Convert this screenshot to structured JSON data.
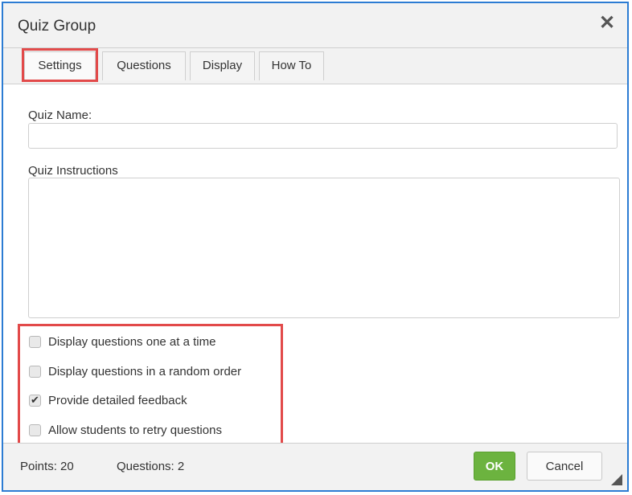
{
  "dialog": {
    "title": "Quiz Group",
    "close_icon": "close-icon"
  },
  "tabs": [
    {
      "label": "Settings",
      "active": true
    },
    {
      "label": "Questions",
      "active": false
    },
    {
      "label": "Display",
      "active": false
    },
    {
      "label": "How To",
      "active": false
    }
  ],
  "form": {
    "quiz_name_label": "Quiz Name:",
    "quiz_name_value": "",
    "quiz_instructions_label": "Quiz Instructions",
    "quiz_instructions_value": ""
  },
  "options": [
    {
      "label": "Display questions one at a time",
      "checked": false
    },
    {
      "label": "Display questions in a random order",
      "checked": false
    },
    {
      "label": "Provide detailed feedback",
      "checked": true
    },
    {
      "label": "Allow students to retry questions",
      "checked": false
    }
  ],
  "footer": {
    "points": "Points: 20",
    "questions": "Questions: 2",
    "ok_label": "OK",
    "cancel_label": "Cancel"
  },
  "colors": {
    "frame_border": "#2c7cd3",
    "highlight": "#e24a4a",
    "ok_button": "#6cb33f"
  }
}
